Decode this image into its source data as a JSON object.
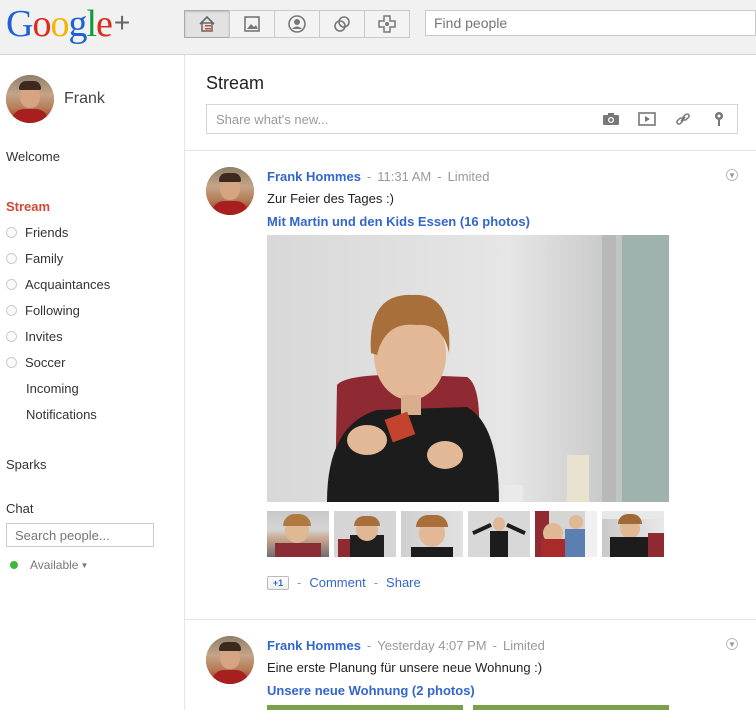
{
  "logo": {
    "text": "Google",
    "plus": "+"
  },
  "topnav": {
    "buttons": [
      "home-icon",
      "photos-icon",
      "profile-icon",
      "circles-icon",
      "games-icon"
    ],
    "active": 0,
    "find_placeholder": "Find people"
  },
  "sidebar": {
    "profile_name": "Frank",
    "welcome": "Welcome",
    "stream": "Stream",
    "circles": [
      "Friends",
      "Family",
      "Acquaintances",
      "Following",
      "Invites",
      "Soccer"
    ],
    "sub_items": [
      "Incoming",
      "Notifications"
    ],
    "sparks": "Sparks",
    "chat": "Chat",
    "chat_search_placeholder": "Search people...",
    "status": "Available",
    "status_color": "#3cba3c"
  },
  "main": {
    "title": "Stream",
    "share_placeholder": "Share what's new...",
    "share_icons": [
      "camera-icon",
      "video-icon",
      "link-icon",
      "location-icon"
    ],
    "posts": [
      {
        "author": "Frank Hommes",
        "time": "11:31 AM",
        "visibility": "Limited",
        "text": "Zur Feier des Tages :)",
        "album": "Mit Martin und den Kids Essen (16 photos)",
        "thumb_count": 6,
        "actions": {
          "plus": "+1",
          "comment": "Comment",
          "share": "Share"
        }
      },
      {
        "author": "Frank Hommes",
        "time": "Yesterday 4:07 PM",
        "visibility": "Limited",
        "text": "Eine erste Planung für unsere neue Wohnung :)",
        "album": "Unsere neue Wohnung (2 photos)"
      }
    ],
    "separator": "-"
  },
  "colors": {
    "link": "#3366cc",
    "active_nav": "#d14836",
    "topbar": "#f1f1f1"
  }
}
